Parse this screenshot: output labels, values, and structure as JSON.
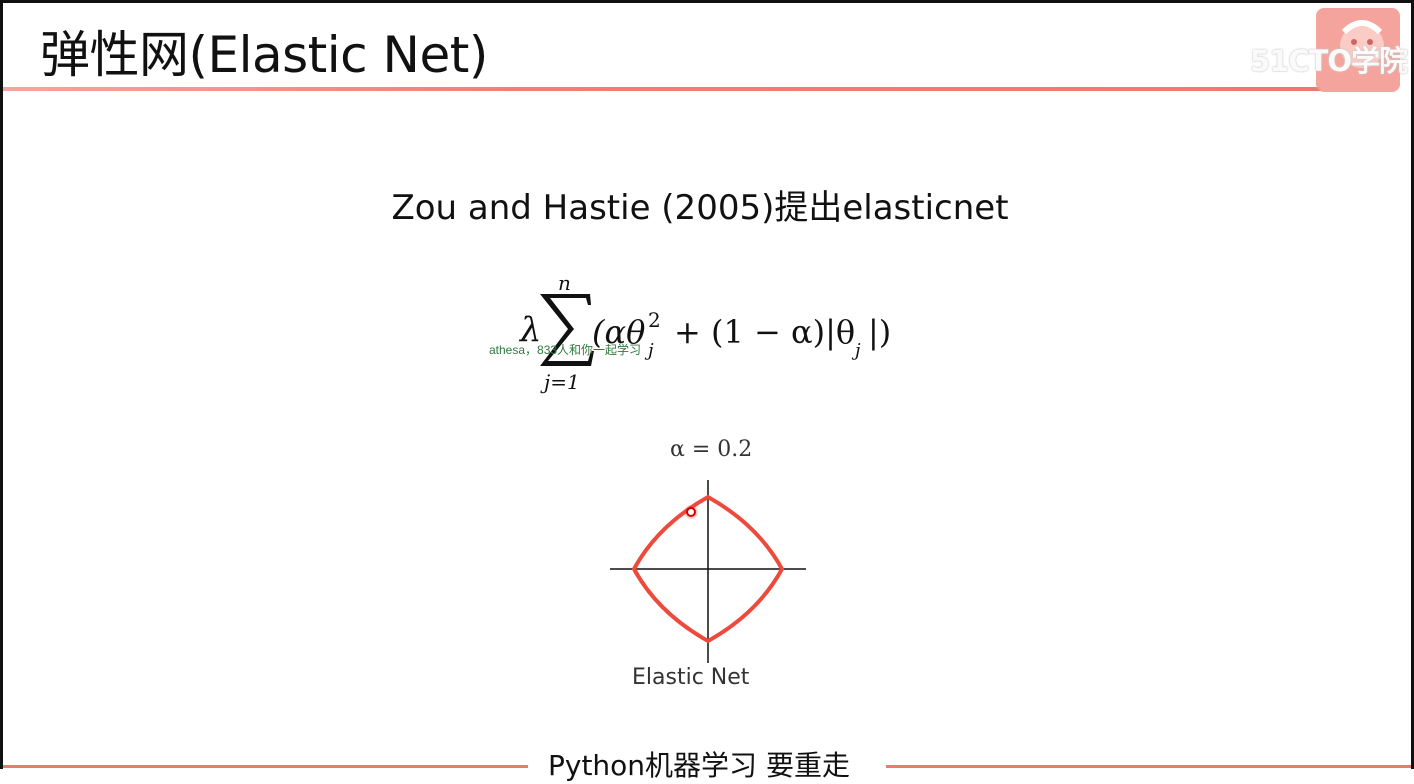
{
  "slide": {
    "title": "弹性网(Elastic Net)",
    "subtitle": "Zou and Hastie (2005)提出elasticnet",
    "logo_text": "51CTO学院",
    "formula": {
      "lambda": "λ",
      "sum_upper": "n",
      "sum_lower": "j=1",
      "body": "(αθ",
      "sup": "2",
      "sub": "j",
      "rest": "+ (1 − α)|θ",
      "sub2": "j",
      "close": "|)"
    },
    "watermark": "athesa，833人和你一起学习",
    "plot": {
      "alpha_label": "α = 0.2",
      "caption": "Elastic Net",
      "curve_color": "#ee4a3c"
    },
    "footer_text": "Python机器学习 要重走"
  }
}
